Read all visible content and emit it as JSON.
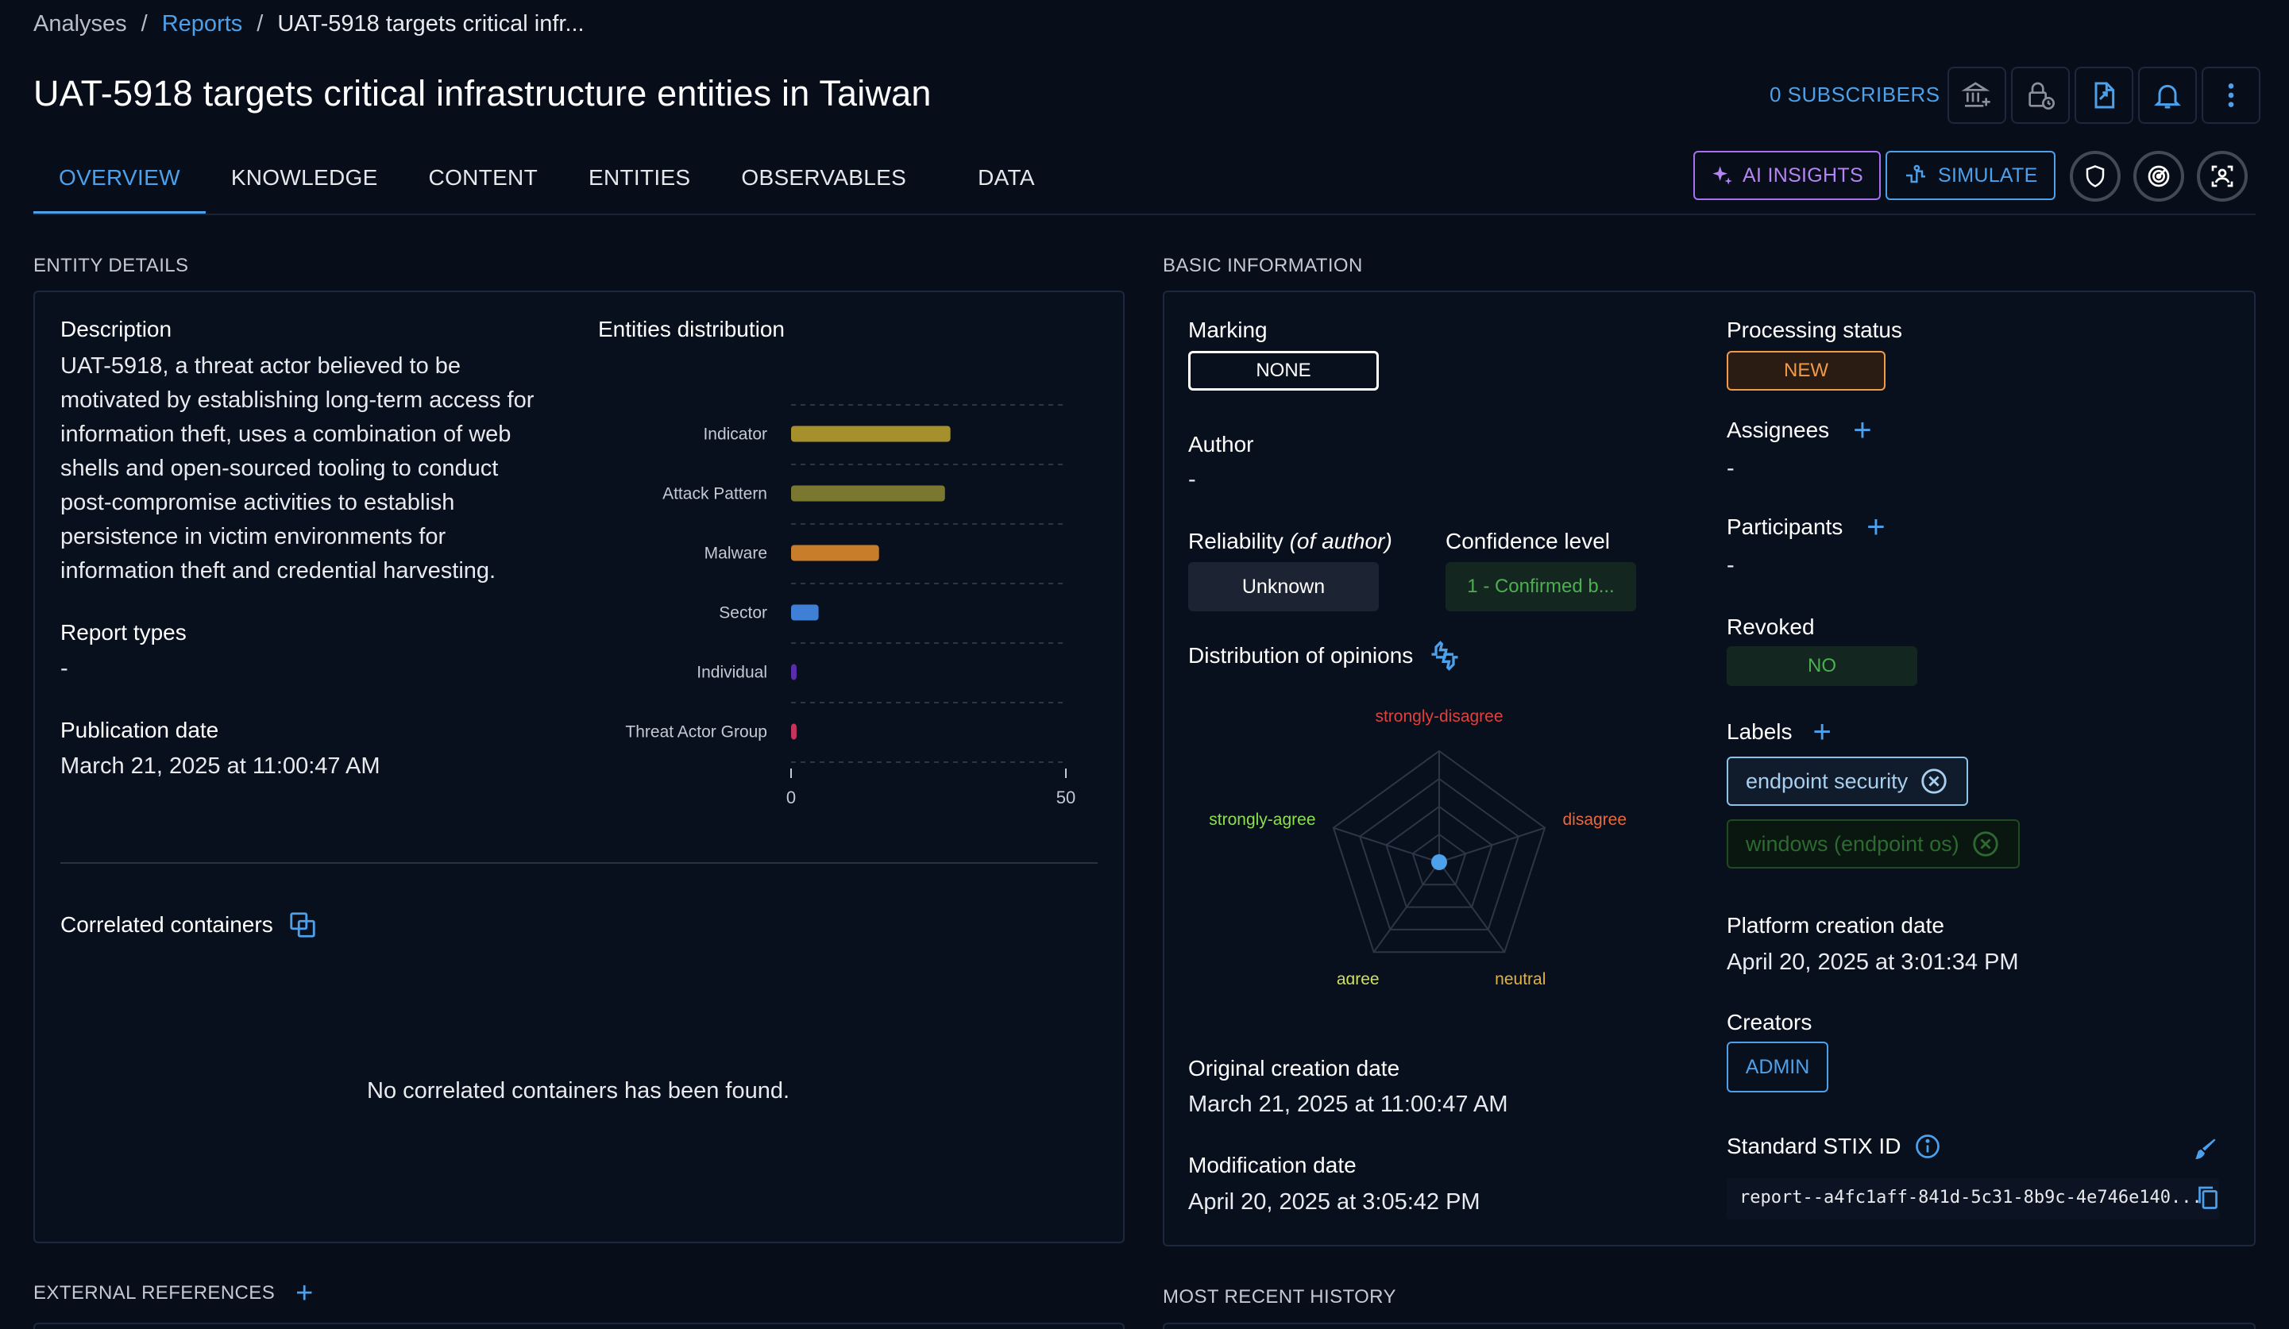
{
  "breadcrumb": {
    "root": "Analyses",
    "sep1": "/",
    "section": "Reports",
    "sep2": "/",
    "current": "UAT-5918 targets critical infr..."
  },
  "header": {
    "title": "UAT-5918 targets critical infrastructure entities in Taiwan",
    "subscribers": "0 SUBSCRIBERS"
  },
  "toolbar": {
    "icons": [
      "bank-plus-icon",
      "lock-clock-icon",
      "file-export-icon",
      "bell-icon",
      "more-vert-icon"
    ]
  },
  "tabs": [
    "OVERVIEW",
    "KNOWLEDGE",
    "CONTENT",
    "ENTITIES",
    "OBSERVABLES",
    "DATA"
  ],
  "actions": {
    "ai_insights": "AI INSIGHTS",
    "simulate": "SIMULATE"
  },
  "entity_details": {
    "section_title": "ENTITY DETAILS",
    "description_label": "Description",
    "description": "UAT-5918, a threat actor believed to be motivated by establishing long-term access for information theft, uses a combination of web shells and open-sourced tooling to conduct post-compromise activities to establish persistence in victim environments for information theft and credential harvesting.",
    "report_types_label": "Report types",
    "report_types": "-",
    "publication_date_label": "Publication date",
    "publication_date": "March 21, 2025 at 11:00:47 AM",
    "entities_distribution_label": "Entities distribution",
    "correlated_label": "Correlated containers",
    "correlated_empty": "No correlated containers has been found."
  },
  "chart_data": {
    "type": "bar",
    "orientation": "horizontal",
    "title": "Entities distribution",
    "categories": [
      "Indicator",
      "Attack Pattern",
      "Malware",
      "Sector",
      "Individual",
      "Threat Actor Group"
    ],
    "values": [
      29,
      28,
      16,
      5,
      1,
      1
    ],
    "colors": [
      "#a6902c",
      "#7a7830",
      "#c77d2a",
      "#3f7fd6",
      "#5a2cae",
      "#c4345f"
    ],
    "xlim": [
      0,
      50
    ],
    "xticks": [
      "0",
      "50"
    ],
    "grid": "horizontal dashed"
  },
  "basic_info": {
    "section_title": "BASIC INFORMATION",
    "marking_label": "Marking",
    "marking": "NONE",
    "author_label": "Author",
    "author": "-",
    "reliability_label": "Reliability",
    "reliability_suffix": "(of author)",
    "reliability": "Unknown",
    "confidence_label": "Confidence level",
    "confidence": "1 - Confirmed b...",
    "opinions_label": "Distribution of opinions",
    "opinions": {
      "axes": [
        "strongly-disagree",
        "disagree",
        "neutral",
        "agree",
        "strongly-agree"
      ],
      "colors": [
        "#e0413d",
        "#e8693b",
        "#e3b23a",
        "#cfe05a",
        "#8ae04f"
      ]
    },
    "original_creation_label": "Original creation date",
    "original_creation": "March 21, 2025 at 11:00:47 AM",
    "modification_label": "Modification date",
    "modification": "April 20, 2025 at 3:05:42 PM",
    "processing_status_label": "Processing status",
    "processing_status": "NEW",
    "assignees_label": "Assignees",
    "assignees": "-",
    "participants_label": "Participants",
    "participants": "-",
    "revoked_label": "Revoked",
    "revoked": "NO",
    "labels_label": "Labels",
    "labels": [
      "endpoint security",
      "windows (endpoint os)"
    ],
    "platform_creation_label": "Platform creation date",
    "platform_creation": "April 20, 2025 at 3:01:34 PM",
    "creators_label": "Creators",
    "creator": "ADMIN",
    "stix_label": "Standard STIX ID",
    "stix_id": "report--a4fc1aff-841d-5c31-8b9c-4e746e140..."
  },
  "external_references": {
    "section_title": "EXTERNAL REFERENCES"
  },
  "recent_history": {
    "section_title": "MOST RECENT HISTORY"
  },
  "colors": {
    "accent": "#4da0ea",
    "background": "#070d19",
    "ai": "#a86ff0",
    "status_new": "#f09a4a",
    "green": "#4caf50"
  }
}
